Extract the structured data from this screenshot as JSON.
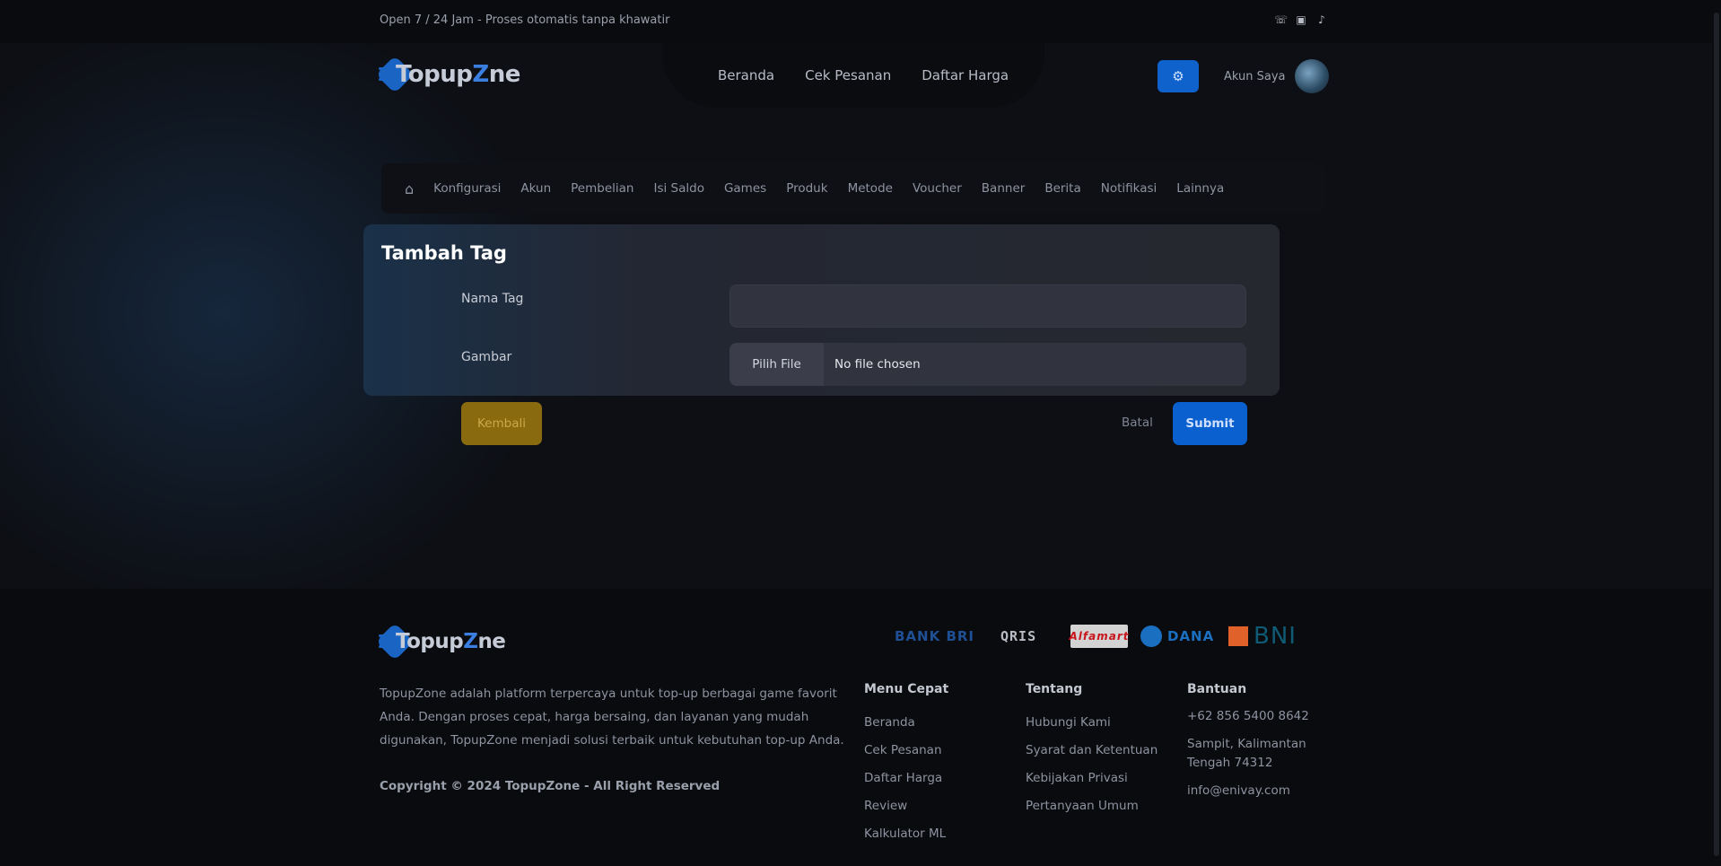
{
  "topbar": {
    "message": "Open 7 / 24 Jam - Proses otomatis tanpa khawatir",
    "social_icons": [
      "whatsapp-icon",
      "instagram-icon",
      "tiktok-icon"
    ]
  },
  "brand": {
    "name_part1": "Topup",
    "name_part2": "Z",
    "name_part3": "ne",
    "accent_color": "#0f62cc"
  },
  "nav": {
    "items": [
      "Beranda",
      "Cek Pesanan",
      "Daftar Harga"
    ]
  },
  "account": {
    "label": "Akun Saya"
  },
  "admin_nav": {
    "items": [
      "Konfigurasi",
      "Akun",
      "Pembelian",
      "Isi Saldo",
      "Games",
      "Produk",
      "Metode",
      "Voucher",
      "Banner",
      "Berita",
      "Notifikasi",
      "Lainnya"
    ]
  },
  "form": {
    "title": "Tambah Tag",
    "name_label": "Nama Tag",
    "name_value": "",
    "image_label": "Gambar",
    "file_button": "Pilih File",
    "file_status": "No file chosen",
    "back_button": "Kembali",
    "cancel_button": "Batal",
    "submit_button": "Submit"
  },
  "footer": {
    "description": "TopupZone adalah platform terpercaya untuk top-up berbagai game favorit Anda. Dengan proses cepat, harga bersaing, dan layanan yang mudah digunakan, TopupZone menjadi solusi terbaik untuk kebutuhan top-up Anda.",
    "copyright": "Copyright © 2024 TopupZone - All Right Reserved",
    "payments": [
      "BANK BRI",
      "QRIS",
      "Alfamart",
      "DANA",
      "BNI"
    ],
    "menu_cepat": {
      "title": "Menu Cepat",
      "links": [
        "Beranda",
        "Cek Pesanan",
        "Daftar Harga",
        "Review",
        "Kalkulator ML"
      ]
    },
    "tentang": {
      "title": "Tentang",
      "links": [
        "Hubungi Kami",
        "Syarat dan Ketentuan",
        "Kebijakan Privasi",
        "Pertanyaan Umum"
      ]
    },
    "bantuan": {
      "title": "Bantuan",
      "phone": "+62 856 5400 8642",
      "address": "Sampit, Kalimantan Tengah 74312",
      "email": "info@enivay.com"
    }
  }
}
